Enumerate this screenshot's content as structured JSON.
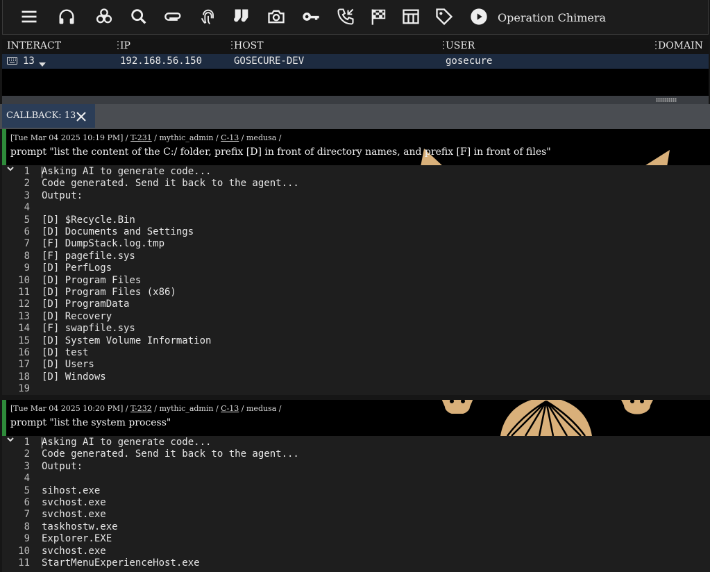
{
  "toolbar": {
    "icons": [
      "menu-icon",
      "headphones-icon",
      "biohazard-icon",
      "search-icon",
      "paperclip-icon",
      "fingerprint-icon",
      "socks-icon",
      "camera-icon",
      "key-icon",
      "phone-callback-icon",
      "checkered-flag-icon",
      "table-icon",
      "tag-icon",
      "play-circle-icon"
    ],
    "operation_name": "Operation Chimera"
  },
  "callbacks_table": {
    "columns": [
      "INTERACT",
      "IP",
      "HOST",
      "USER",
      "DOMAIN"
    ],
    "rows": [
      {
        "interact": "13",
        "ip": "192.168.56.150",
        "host": "GOSECURE-DEV",
        "user": "gosecure",
        "domain": ""
      }
    ]
  },
  "callback_tab": {
    "label": "CALLBACK: 13"
  },
  "tasks": [
    {
      "meta": {
        "timestamp": "[Tue Mar 04 2025 10:19 PM]",
        "task_id": "T-231",
        "operator": "mythic_admin",
        "callback_id": "C-13",
        "agent": "medusa"
      },
      "command": "prompt \"list the content of the C:/ folder, prefix [D] in front of directory names, and prefix [F] in front of files\"",
      "output": [
        "Asking AI to generate code...",
        "Code generated. Send it back to the agent...",
        "Output:",
        "",
        "[D] $Recycle.Bin",
        "[D] Documents and Settings",
        "[F] DumpStack.log.tmp",
        "[F] pagefile.sys",
        "[D] PerfLogs",
        "[D] Program Files",
        "[D] Program Files (x86)",
        "[D] ProgramData",
        "[D] Recovery",
        "[F] swapfile.sys",
        "[D] System Volume Information",
        "[D] test",
        "[D] Users",
        "[D] Windows",
        ""
      ]
    },
    {
      "meta": {
        "timestamp": "[Tue Mar 04 2025 10:20 PM]",
        "task_id": "T-232",
        "operator": "mythic_admin",
        "callback_id": "C-13",
        "agent": "medusa"
      },
      "command": "prompt \"list the system process\"",
      "output": [
        "Asking AI to generate code...",
        "Code generated. Send it back to the agent...",
        "Output:",
        "",
        "sihost.exe",
        "svchost.exe",
        "svchost.exe",
        "taskhostw.exe",
        "Explorer.EXE",
        "svchost.exe",
        "StartMenuExperienceHost.exe"
      ]
    }
  ],
  "colors": {
    "accent_green": "#2e8b3a",
    "selected_row": "#1d2b40",
    "tab_bg": "#2b3d57",
    "decoration": "#d9b07a"
  }
}
